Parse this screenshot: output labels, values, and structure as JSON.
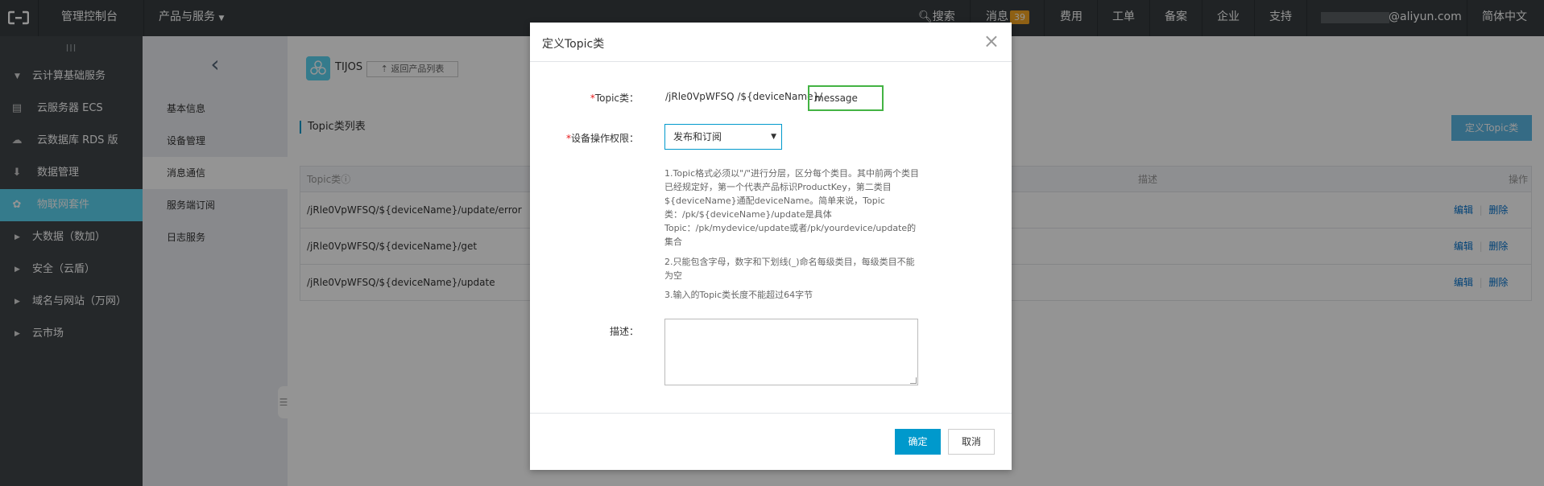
{
  "topbar": {
    "console": "管理控制台",
    "products": "产品与服务",
    "search": "搜索",
    "messages": "消息",
    "message_count": "39",
    "fees": "费用",
    "tickets": "工单",
    "beian": "备案",
    "enterprise": "企业",
    "support": "支持",
    "account": "@aliyun.com",
    "language": "简体中文"
  },
  "sidebar": {
    "collapse": "III",
    "section": "云计算基础服务",
    "items": [
      {
        "label": "云服务器 ECS",
        "icon": "server-icon"
      },
      {
        "label": "云数据库 RDS 版",
        "icon": "database-icon"
      },
      {
        "label": "数据管理",
        "icon": "data-management-icon"
      },
      {
        "label": "物联网套件",
        "icon": "iot-icon"
      }
    ],
    "groups": [
      "大数据（数加）",
      "安全（云盾）",
      "域名与网站（万网）",
      "云市场"
    ]
  },
  "subnav": {
    "items": [
      "基本信息",
      "设备管理",
      "消息通信",
      "服务端订阅",
      "日志服务"
    ],
    "active_index": 2
  },
  "product": {
    "name": "TIJOS",
    "back_label": "返回产品列表"
  },
  "section_title": "Topic类列表",
  "define_button": "定义Topic类",
  "table": {
    "headers": {
      "topic": "Topic类",
      "desc": "描述",
      "ops": "操作"
    },
    "rows": [
      {
        "topic": "/jRle0VpWFSQ/${deviceName}/update/error"
      },
      {
        "topic": "/jRle0VpWFSQ/${deviceName}/get"
      },
      {
        "topic": "/jRle0VpWFSQ/${deviceName}/update"
      }
    ],
    "edit": "编辑",
    "delete": "删除"
  },
  "modal": {
    "title": "定义Topic类",
    "topic_label": "Topic类：",
    "topic_prefix": "/jRle0VpWFSQ /${deviceName}/",
    "topic_value": "message",
    "perm_label": "设备操作权限：",
    "perm_value": "发布和订阅",
    "help": [
      "1.Topic格式必须以\"/\"进行分层，区分每个类目。其中前两个类目已经规定好，第一个代表产品标识ProductKey，第二类目${deviceName}通配deviceName。简单来说，Topic类：/pk/${deviceName}/update是具体Topic：/pk/mydevice/update或者/pk/yourdevice/update的集合",
      "2.只能包含字母，数字和下划线(_)命名每级类目，每级类目不能为空",
      "3.输入的Topic类长度不能超过64字节"
    ],
    "desc_label": "描述：",
    "ok": "确定",
    "cancel": "取消"
  },
  "colors": {
    "topbar": "#373d41",
    "sidebar": "#404549",
    "active": "#5cd5f1",
    "primary": "#0099cc",
    "input_focus": "#43b343"
  }
}
